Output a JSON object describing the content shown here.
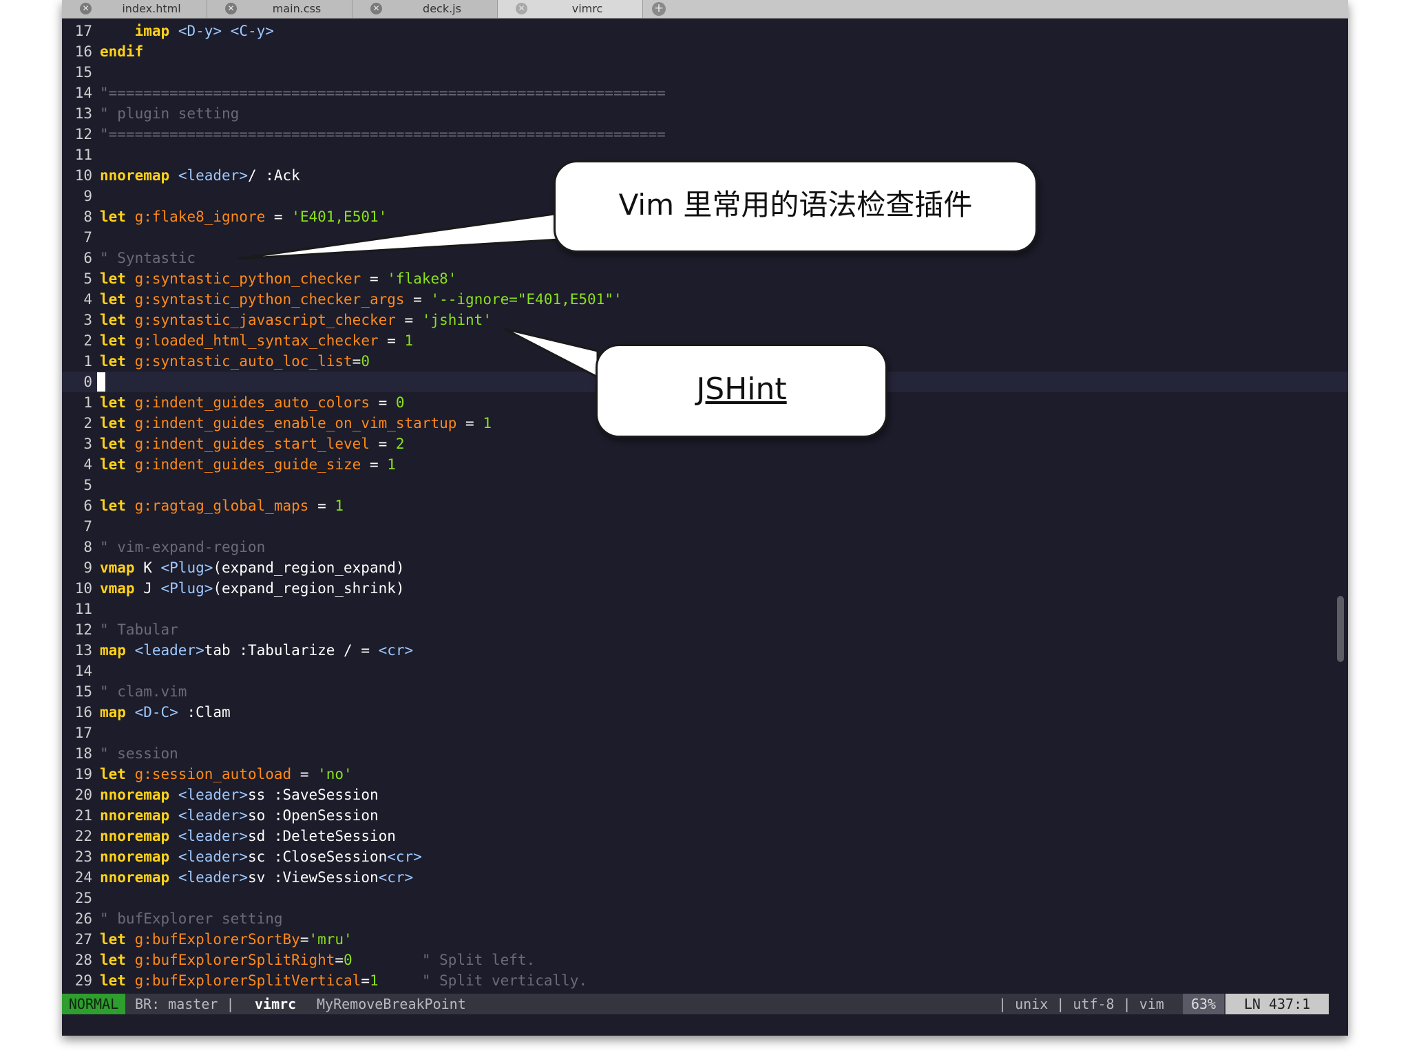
{
  "tabs": [
    {
      "label": "index.html",
      "active": false
    },
    {
      "label": "main.css",
      "active": false
    },
    {
      "label": "deck.js",
      "active": false
    },
    {
      "label": "vimrc",
      "active": true
    }
  ],
  "lines": [
    {
      "n": "17",
      "t": [
        [
          "",
          "    "
        ],
        [
          "kw",
          "imap"
        ],
        [
          "op",
          " "
        ],
        [
          "tag",
          "<D-y>"
        ],
        [
          "op",
          " "
        ],
        [
          "tag",
          "<C-y>"
        ]
      ]
    },
    {
      "n": "16",
      "t": [
        [
          "kw",
          "endif"
        ]
      ]
    },
    {
      "n": "15",
      "t": []
    },
    {
      "n": "14",
      "t": [
        [
          "cmt",
          "\"================================================================"
        ]
      ]
    },
    {
      "n": "13",
      "t": [
        [
          "cmt",
          "\" plugin setting"
        ]
      ]
    },
    {
      "n": "12",
      "t": [
        [
          "cmt",
          "\"================================================================"
        ]
      ]
    },
    {
      "n": "11",
      "t": []
    },
    {
      "n": "10",
      "t": [
        [
          "kw",
          "nnoremap"
        ],
        [
          "op",
          " "
        ],
        [
          "tag",
          "<leader>"
        ],
        [
          "op",
          "/ :Ack"
        ]
      ]
    },
    {
      "n": "9",
      "t": []
    },
    {
      "n": "8",
      "t": [
        [
          "kw",
          "let"
        ],
        [
          "op",
          " "
        ],
        [
          "var",
          "g:flake8_ignore"
        ],
        [
          "op",
          " = "
        ],
        [
          "str",
          "'E401,E501'"
        ]
      ]
    },
    {
      "n": "7",
      "t": []
    },
    {
      "n": "6",
      "t": [
        [
          "cmt",
          "\" Syntastic"
        ]
      ]
    },
    {
      "n": "5",
      "t": [
        [
          "kw",
          "let"
        ],
        [
          "op",
          " "
        ],
        [
          "var",
          "g:syntastic_python_checker"
        ],
        [
          "op",
          " = "
        ],
        [
          "str",
          "'flake8'"
        ]
      ]
    },
    {
      "n": "4",
      "t": [
        [
          "kw",
          "let"
        ],
        [
          "op",
          " "
        ],
        [
          "var",
          "g:syntastic_python_checker_args"
        ],
        [
          "op",
          " = "
        ],
        [
          "str",
          "'--ignore=\"E401,E501\"'"
        ]
      ]
    },
    {
      "n": "3",
      "t": [
        [
          "kw",
          "let"
        ],
        [
          "op",
          " "
        ],
        [
          "var",
          "g:syntastic_javascript_checker"
        ],
        [
          "op",
          " = "
        ],
        [
          "str",
          "'jshint'"
        ]
      ]
    },
    {
      "n": "2",
      "t": [
        [
          "kw",
          "let"
        ],
        [
          "op",
          " "
        ],
        [
          "var",
          "g:loaded_html_syntax_checker"
        ],
        [
          "op",
          " = "
        ],
        [
          "str",
          "1"
        ]
      ]
    },
    {
      "n": "1",
      "t": [
        [
          "kw",
          "let"
        ],
        [
          "op",
          " "
        ],
        [
          "var",
          "g:syntastic_auto_loc_list"
        ],
        [
          "op",
          "="
        ],
        [
          "str",
          "0"
        ]
      ]
    },
    {
      "n": "0",
      "t": [],
      "current": true
    },
    {
      "n": "1",
      "t": [
        [
          "kw",
          "let"
        ],
        [
          "op",
          " "
        ],
        [
          "var",
          "g:indent_guides_auto_colors"
        ],
        [
          "op",
          " = "
        ],
        [
          "str",
          "0"
        ]
      ]
    },
    {
      "n": "2",
      "t": [
        [
          "kw",
          "let"
        ],
        [
          "op",
          " "
        ],
        [
          "var",
          "g:indent_guides_enable_on_vim_startup"
        ],
        [
          "op",
          " = "
        ],
        [
          "str",
          "1"
        ]
      ]
    },
    {
      "n": "3",
      "t": [
        [
          "kw",
          "let"
        ],
        [
          "op",
          " "
        ],
        [
          "var",
          "g:indent_guides_start_level"
        ],
        [
          "op",
          " = "
        ],
        [
          "str",
          "2"
        ]
      ]
    },
    {
      "n": "4",
      "t": [
        [
          "kw",
          "let"
        ],
        [
          "op",
          " "
        ],
        [
          "var",
          "g:indent_guides_guide_size"
        ],
        [
          "op",
          " = "
        ],
        [
          "str",
          "1"
        ]
      ]
    },
    {
      "n": "5",
      "t": []
    },
    {
      "n": "6",
      "t": [
        [
          "kw",
          "let"
        ],
        [
          "op",
          " "
        ],
        [
          "var",
          "g:ragtag_global_maps"
        ],
        [
          "op",
          " = "
        ],
        [
          "str",
          "1"
        ]
      ]
    },
    {
      "n": "7",
      "t": []
    },
    {
      "n": "8",
      "t": [
        [
          "cmt",
          "\" vim-expand-region"
        ]
      ]
    },
    {
      "n": "9",
      "t": [
        [
          "kw",
          "vmap"
        ],
        [
          "op",
          " K "
        ],
        [
          "tag",
          "<Plug>"
        ],
        [
          "op",
          "(expand_region_expand)"
        ]
      ]
    },
    {
      "n": "10",
      "t": [
        [
          "kw",
          "vmap"
        ],
        [
          "op",
          " J "
        ],
        [
          "tag",
          "<Plug>"
        ],
        [
          "op",
          "(expand_region_shrink)"
        ]
      ]
    },
    {
      "n": "11",
      "t": []
    },
    {
      "n": "12",
      "t": [
        [
          "cmt",
          "\" Tabular"
        ]
      ]
    },
    {
      "n": "13",
      "t": [
        [
          "kw",
          "map"
        ],
        [
          "op",
          " "
        ],
        [
          "tag",
          "<leader>"
        ],
        [
          "op",
          "tab :Tabularize / = "
        ],
        [
          "tag",
          "<cr>"
        ]
      ]
    },
    {
      "n": "14",
      "t": []
    },
    {
      "n": "15",
      "t": [
        [
          "cmt",
          "\" clam.vim"
        ]
      ]
    },
    {
      "n": "16",
      "t": [
        [
          "kw",
          "map"
        ],
        [
          "op",
          " "
        ],
        [
          "tag",
          "<D-C>"
        ],
        [
          "op",
          " :Clam"
        ]
      ]
    },
    {
      "n": "17",
      "t": []
    },
    {
      "n": "18",
      "t": [
        [
          "cmt",
          "\" session"
        ]
      ]
    },
    {
      "n": "19",
      "t": [
        [
          "kw",
          "let"
        ],
        [
          "op",
          " "
        ],
        [
          "var",
          "g:session_autoload"
        ],
        [
          "op",
          " = "
        ],
        [
          "str",
          "'no'"
        ]
      ]
    },
    {
      "n": "20",
      "t": [
        [
          "kw",
          "nnoremap"
        ],
        [
          "op",
          " "
        ],
        [
          "tag",
          "<leader>"
        ],
        [
          "op",
          "ss :SaveSession"
        ]
      ]
    },
    {
      "n": "21",
      "t": [
        [
          "kw",
          "nnoremap"
        ],
        [
          "op",
          " "
        ],
        [
          "tag",
          "<leader>"
        ],
        [
          "op",
          "so :OpenSession"
        ]
      ]
    },
    {
      "n": "22",
      "t": [
        [
          "kw",
          "nnoremap"
        ],
        [
          "op",
          " "
        ],
        [
          "tag",
          "<leader>"
        ],
        [
          "op",
          "sd :DeleteSession"
        ]
      ]
    },
    {
      "n": "23",
      "t": [
        [
          "kw",
          "nnoremap"
        ],
        [
          "op",
          " "
        ],
        [
          "tag",
          "<leader>"
        ],
        [
          "op",
          "sc :CloseSession"
        ],
        [
          "tag",
          "<cr>"
        ]
      ]
    },
    {
      "n": "24",
      "t": [
        [
          "kw",
          "nnoremap"
        ],
        [
          "op",
          " "
        ],
        [
          "tag",
          "<leader>"
        ],
        [
          "op",
          "sv :ViewSession"
        ],
        [
          "tag",
          "<cr>"
        ]
      ]
    },
    {
      "n": "25",
      "t": []
    },
    {
      "n": "26",
      "t": [
        [
          "cmt",
          "\" bufExplorer setting"
        ]
      ]
    },
    {
      "n": "27",
      "t": [
        [
          "kw",
          "let"
        ],
        [
          "op",
          " "
        ],
        [
          "var",
          "g:bufExplorerSortBy"
        ],
        [
          "op",
          "="
        ],
        [
          "str",
          "'mru'"
        ]
      ]
    },
    {
      "n": "28",
      "t": [
        [
          "kw",
          "let"
        ],
        [
          "op",
          " "
        ],
        [
          "var",
          "g:bufExplorerSplitRight"
        ],
        [
          "op",
          "="
        ],
        [
          "str",
          "0"
        ],
        [
          "op",
          "        "
        ],
        [
          "cmt",
          "\" Split left."
        ]
      ]
    },
    {
      "n": "29",
      "t": [
        [
          "kw",
          "let"
        ],
        [
          "op",
          " "
        ],
        [
          "var",
          "g:bufExplorerSplitVertical"
        ],
        [
          "op",
          "="
        ],
        [
          "str",
          "1"
        ],
        [
          "op",
          "     "
        ],
        [
          "cmt",
          "\" Split vertically."
        ]
      ]
    }
  ],
  "status": {
    "mode": "NORMAL",
    "branch": "BR: master |",
    "file": "vimrc",
    "function": "MyRemoveBreakPoint",
    "encoding": "| unix | utf-8 | vim",
    "percent": "63%",
    "position": "LN 437:1"
  },
  "callouts": {
    "syntax_plugins": "Vim 里常用的语法检查插件",
    "jshint": "JSHint"
  },
  "colors": {
    "background": "#1c1c2a",
    "keyword": "#ffd21a",
    "variable": "#ff8a1a",
    "string": "#8be11d",
    "comment": "#6a6a78",
    "mode_normal": "#2e9e2e"
  }
}
